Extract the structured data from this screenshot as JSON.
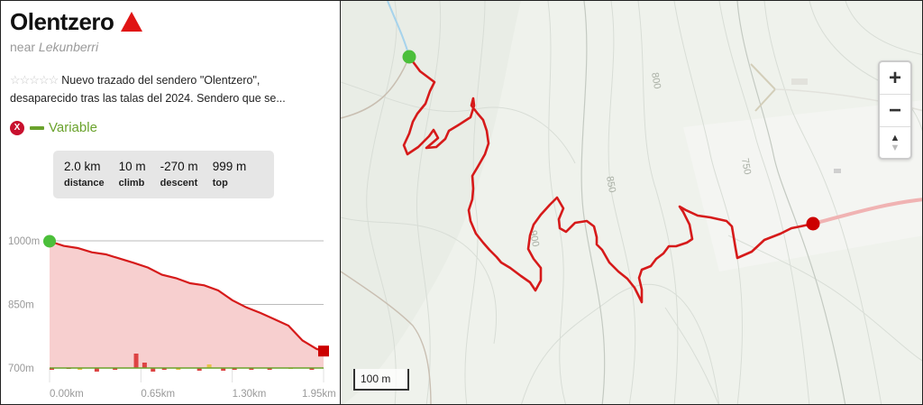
{
  "route": {
    "title": "Olentzero",
    "near_prefix": "near",
    "near_place": "Lekunberri",
    "rating_stars": "☆☆☆☆☆",
    "description": "Nuevo trazado del sendero \"Olentzero\", desaparecido tras las talas del 2024. Sendero que se...",
    "difficulty": "Variable",
    "difficulty_icon": "x-circle-icon",
    "difficulty_mark": "X"
  },
  "stats": [
    {
      "value": "2.0 km",
      "label": "distance"
    },
    {
      "value": "10 m",
      "label": "climb"
    },
    {
      "value": "-270 m",
      "label": "descent"
    },
    {
      "value": "999 m",
      "label": "top"
    }
  ],
  "chart_data": {
    "type": "area",
    "title": "",
    "xlabel": "",
    "ylabel": "",
    "y_ticks": [
      "1000m",
      "850m",
      "700m"
    ],
    "x_ticks": [
      "0.00km",
      "0.65km",
      "1.30km",
      "1.95km"
    ],
    "ylim": [
      700,
      1000
    ],
    "xlim": [
      0,
      1.95
    ],
    "series": [
      {
        "x": [
          0,
          0.1,
          0.2,
          0.3,
          0.4,
          0.5,
          0.6,
          0.7,
          0.8,
          0.9,
          1.0,
          1.1,
          1.2,
          1.3,
          1.4,
          1.5,
          1.6,
          1.7,
          1.8,
          1.9,
          1.95
        ],
        "y": [
          999,
          988,
          983,
          973,
          968,
          958,
          948,
          937,
          920,
          912,
          900,
          895,
          883,
          860,
          843,
          830,
          815,
          800,
          765,
          745,
          740
        ],
        "colors": {
          "line": "#d61a1a",
          "fill": "#f7cfcf"
        }
      }
    ],
    "start_marker_color": "#4bbf3a",
    "end_marker_color": "#cc0000"
  },
  "map": {
    "contour_labels": [
      "800",
      "850",
      "900",
      "750"
    ],
    "zoom_in": "+",
    "zoom_out": "−",
    "compass_up": "▲",
    "compass_down": "▼",
    "scale_label": "100 m",
    "route_color": "#d61a1a",
    "start_color": "#4bbf3a",
    "end_color": "#cc0000"
  }
}
